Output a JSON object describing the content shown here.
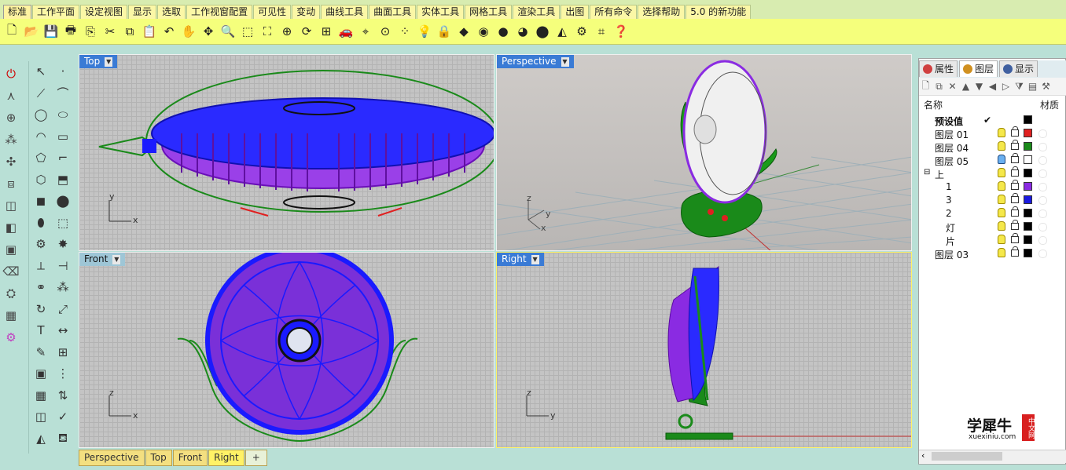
{
  "menu_tabs": [
    "标准",
    "工作平面",
    "设定视图",
    "显示",
    "选取",
    "工作视窗配置",
    "可见性",
    "变动",
    "曲线工具",
    "曲面工具",
    "实体工具",
    "网格工具",
    "渲染工具",
    "出图",
    "所有命令",
    "选择帮助",
    "5.0 的新功能"
  ],
  "active_menu_tab": "标准",
  "viewports": {
    "top": {
      "title": "Top",
      "axis_x": "x",
      "axis_y": "y"
    },
    "perspective": {
      "title": "Perspective",
      "axis_x": "x",
      "axis_y": "y",
      "axis_z": "z"
    },
    "front": {
      "title": "Front",
      "axis_x": "x",
      "axis_y": "z"
    },
    "right": {
      "title": "Right",
      "axis_x": "y",
      "axis_y": "z"
    }
  },
  "viewport_tabs": [
    "Perspective",
    "Top",
    "Front",
    "Right"
  ],
  "active_viewport_tab": "Right",
  "add_tab": "+",
  "panel": {
    "tabs": [
      {
        "label": "属性",
        "icon": "properties-icon"
      },
      {
        "label": "图层",
        "icon": "layers-icon"
      },
      {
        "label": "显示",
        "icon": "display-icon"
      }
    ],
    "active_tab": "图层",
    "header_name": "名称",
    "header_material": "材质",
    "layers": [
      {
        "name": "预设值",
        "bold": true,
        "check": "✔",
        "color": "#000000",
        "indent": 0
      },
      {
        "name": "图层 01",
        "color": "#e02020",
        "indent": 0
      },
      {
        "name": "图层 04",
        "color": "#1a8a1a",
        "indent": 0
      },
      {
        "name": "图层 05",
        "color": "#ffffff",
        "indent": 0,
        "bulb": "blue"
      },
      {
        "name": "上",
        "color": "#000000",
        "indent": 0,
        "expander": "⊟"
      },
      {
        "name": "1",
        "color": "#8a2be2",
        "indent": 2
      },
      {
        "name": "3",
        "color": "#1a1ae0",
        "indent": 2
      },
      {
        "name": "2",
        "color": "#000000",
        "indent": 2
      },
      {
        "name": "灯",
        "color": "#000000",
        "indent": 2
      },
      {
        "name": "片",
        "color": "#000000",
        "indent": 2
      },
      {
        "name": "图层 03",
        "color": "#000000",
        "indent": 0
      }
    ]
  },
  "watermark": {
    "text": "学犀牛",
    "url": "xuexiniu.com",
    "seal": "中文网"
  },
  "colors": {
    "viewport_title_bg": "#3a7bd5",
    "fan_blue": "#1a1aff",
    "fan_purple": "#8a2be2",
    "fan_green": "#1a8a1a",
    "active_border": "#fff266"
  }
}
